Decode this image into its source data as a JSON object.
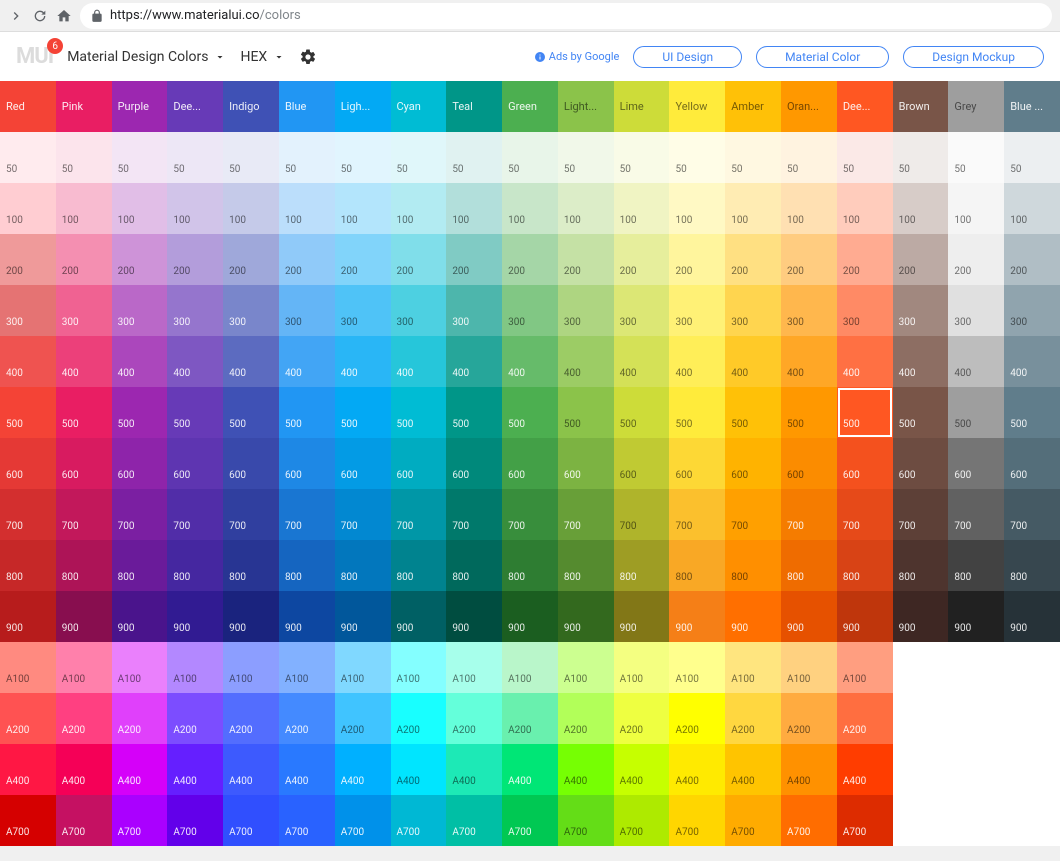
{
  "browser": {
    "url_protocol": "https://",
    "url_domain": "www.materialui.co",
    "url_path": "/colors"
  },
  "header": {
    "logo": "MUI",
    "badge": "6",
    "title": "Material Design Colors",
    "format": "HEX",
    "ads": "Ads by Google",
    "links": [
      "UI Design",
      "Material Color",
      "Design Mockup"
    ]
  },
  "colors": [
    {
      "name": "Red",
      "short": "Red",
      "shades": {
        "500": "#F44336",
        "50": "#FFEBEE",
        "100": "#FFCDD2",
        "200": "#EF9A9A",
        "300": "#E57373",
        "400": "#EF5350",
        "600": "#E53935",
        "700": "#D32F2F",
        "800": "#C62828",
        "900": "#B71C1C",
        "A100": "#FF8A80",
        "A200": "#FF5252",
        "A400": "#FF1744",
        "A700": "#D50000"
      }
    },
    {
      "name": "Pink",
      "short": "Pink",
      "shades": {
        "500": "#E91E63",
        "50": "#FCE4EC",
        "100": "#F8BBD0",
        "200": "#F48FB1",
        "300": "#F06292",
        "400": "#EC407A",
        "600": "#D81B60",
        "700": "#C2185B",
        "800": "#AD1457",
        "900": "#880E4F",
        "A100": "#FF80AB",
        "A200": "#FF4081",
        "A400": "#F50057",
        "A700": "#C51162"
      }
    },
    {
      "name": "Purple",
      "short": "Purple",
      "shades": {
        "500": "#9C27B0",
        "50": "#F3E5F5",
        "100": "#E1BEE7",
        "200": "#CE93D8",
        "300": "#BA68C8",
        "400": "#AB47BC",
        "600": "#8E24AA",
        "700": "#7B1FA2",
        "800": "#6A1B9A",
        "900": "#4A148C",
        "A100": "#EA80FC",
        "A200": "#E040FB",
        "A400": "#D500F9",
        "A700": "#AA00FF"
      }
    },
    {
      "name": "Deep Purple",
      "short": "Dee...",
      "shades": {
        "500": "#673AB7",
        "50": "#EDE7F6",
        "100": "#D1C4E9",
        "200": "#B39DDB",
        "300": "#9575CD",
        "400": "#7E57C2",
        "600": "#5E35B1",
        "700": "#512DA8",
        "800": "#4527A0",
        "900": "#311B92",
        "A100": "#B388FF",
        "A200": "#7C4DFF",
        "A400": "#651FFF",
        "A700": "#6200EA"
      }
    },
    {
      "name": "Indigo",
      "short": "Indigo",
      "shades": {
        "500": "#3F51B5",
        "50": "#E8EAF6",
        "100": "#C5CAE9",
        "200": "#9FA8DA",
        "300": "#7986CB",
        "400": "#5C6BC0",
        "600": "#3949AB",
        "700": "#303F9F",
        "800": "#283593",
        "900": "#1A237E",
        "A100": "#8C9EFF",
        "A200": "#536DFE",
        "A400": "#3D5AFE",
        "A700": "#304FFE"
      }
    },
    {
      "name": "Blue",
      "short": "Blue",
      "shades": {
        "500": "#2196F3",
        "50": "#E3F2FD",
        "100": "#BBDEFB",
        "200": "#90CAF9",
        "300": "#64B5F6",
        "400": "#42A5F5",
        "600": "#1E88E5",
        "700": "#1976D2",
        "800": "#1565C0",
        "900": "#0D47A1",
        "A100": "#82B1FF",
        "A200": "#448AFF",
        "A400": "#2979FF",
        "A700": "#2962FF"
      }
    },
    {
      "name": "Light Blue",
      "short": "Ligh...",
      "shades": {
        "500": "#03A9F4",
        "50": "#E1F5FE",
        "100": "#B3E5FC",
        "200": "#81D4FA",
        "300": "#4FC3F7",
        "400": "#29B6F6",
        "600": "#039BE5",
        "700": "#0288D1",
        "800": "#0277BD",
        "900": "#01579B",
        "A100": "#80D8FF",
        "A200": "#40C4FF",
        "A400": "#00B0FF",
        "A700": "#0091EA"
      }
    },
    {
      "name": "Cyan",
      "short": "Cyan",
      "shades": {
        "500": "#00BCD4",
        "50": "#E0F7FA",
        "100": "#B2EBF2",
        "200": "#80DEEA",
        "300": "#4DD0E1",
        "400": "#26C6DA",
        "600": "#00ACC1",
        "700": "#0097A7",
        "800": "#00838F",
        "900": "#006064",
        "A100": "#84FFFF",
        "A200": "#18FFFF",
        "A400": "#00E5FF",
        "A700": "#00B8D4"
      }
    },
    {
      "name": "Teal",
      "short": "Teal",
      "shades": {
        "500": "#009688",
        "50": "#E0F2F1",
        "100": "#B2DFDB",
        "200": "#80CBC4",
        "300": "#4DB6AC",
        "400": "#26A69A",
        "600": "#00897B",
        "700": "#00796B",
        "800": "#00695C",
        "900": "#004D40",
        "A100": "#A7FFEB",
        "A200": "#64FFDA",
        "A400": "#1DE9B6",
        "A700": "#00BFA5"
      }
    },
    {
      "name": "Green",
      "short": "Green",
      "shades": {
        "500": "#4CAF50",
        "50": "#E8F5E9",
        "100": "#C8E6C9",
        "200": "#A5D6A7",
        "300": "#81C784",
        "400": "#66BB6A",
        "600": "#43A047",
        "700": "#388E3C",
        "800": "#2E7D32",
        "900": "#1B5E20",
        "A100": "#B9F6CA",
        "A200": "#69F0AE",
        "A400": "#00E676",
        "A700": "#00C853"
      }
    },
    {
      "name": "Light Green",
      "short": "Light...",
      "shades": {
        "500": "#8BC34A",
        "50": "#F1F8E9",
        "100": "#DCEDC8",
        "200": "#C5E1A5",
        "300": "#AED581",
        "400": "#9CCC65",
        "600": "#7CB342",
        "700": "#689F38",
        "800": "#558B2F",
        "900": "#33691E",
        "A100": "#CCFF90",
        "A200": "#B2FF59",
        "A400": "#76FF03",
        "A700": "#64DD17"
      }
    },
    {
      "name": "Lime",
      "short": "Lime",
      "shades": {
        "500": "#CDDC39",
        "50": "#F9FBE7",
        "100": "#F0F4C3",
        "200": "#E6EE9C",
        "300": "#DCE775",
        "400": "#D4E157",
        "600": "#C0CA33",
        "700": "#AFB42B",
        "800": "#9E9D24",
        "900": "#827717",
        "A100": "#F4FF81",
        "A200": "#EEFF41",
        "A400": "#C6FF00",
        "A700": "#AEEA00"
      }
    },
    {
      "name": "Yellow",
      "short": "Yellow",
      "shades": {
        "500": "#FFEB3B",
        "50": "#FFFDE7",
        "100": "#FFF9C4",
        "200": "#FFF59D",
        "300": "#FFF176",
        "400": "#FFEE58",
        "600": "#FDD835",
        "700": "#FBC02D",
        "800": "#F9A825",
        "900": "#F57F17",
        "A100": "#FFFF8D",
        "A200": "#FFFF00",
        "A400": "#FFEA00",
        "A700": "#FFD600"
      }
    },
    {
      "name": "Amber",
      "short": "Amber",
      "shades": {
        "500": "#FFC107",
        "50": "#FFF8E1",
        "100": "#FFECB3",
        "200": "#FFE082",
        "300": "#FFD54F",
        "400": "#FFCA28",
        "600": "#FFB300",
        "700": "#FFA000",
        "800": "#FF8F00",
        "900": "#FF6F00",
        "A100": "#FFE57F",
        "A200": "#FFD740",
        "A400": "#FFC400",
        "A700": "#FFAB00"
      }
    },
    {
      "name": "Orange",
      "short": "Oran...",
      "shades": {
        "500": "#FF9800",
        "50": "#FFF3E0",
        "100": "#FFE0B2",
        "200": "#FFCC80",
        "300": "#FFB74D",
        "400": "#FFA726",
        "600": "#FB8C00",
        "700": "#F57C00",
        "800": "#EF6C00",
        "900": "#E65100",
        "A100": "#FFD180",
        "A200": "#FFAB40",
        "A400": "#FF9100",
        "A700": "#FF6D00"
      }
    },
    {
      "name": "Deep Orange",
      "short": "Dee...",
      "shades": {
        "500": "#FF5722",
        "50": "#FBE9E7",
        "100": "#FFCCBC",
        "200": "#FFAB91",
        "300": "#FF8A65",
        "400": "#FF7043",
        "600": "#F4511E",
        "700": "#E64A19",
        "800": "#D84315",
        "900": "#BF360C",
        "A100": "#FF9E80",
        "A200": "#FF6E40",
        "A400": "#FF3D00",
        "A700": "#DD2C00"
      }
    },
    {
      "name": "Brown",
      "short": "Brown",
      "shades": {
        "500": "#795548",
        "50": "#EFEBE9",
        "100": "#D7CCC8",
        "200": "#BCAAA4",
        "300": "#A1887F",
        "400": "#8D6E63",
        "600": "#6D4C41",
        "700": "#5D4037",
        "800": "#4E342E",
        "900": "#3E2723"
      }
    },
    {
      "name": "Grey",
      "short": "Grey",
      "shades": {
        "500": "#9E9E9E",
        "50": "#FAFAFA",
        "100": "#F5F5F5",
        "200": "#EEEEEE",
        "300": "#E0E0E0",
        "400": "#BDBDBD",
        "600": "#757575",
        "700": "#616161",
        "800": "#424242",
        "900": "#212121"
      }
    },
    {
      "name": "Blue Grey",
      "short": "Blue ...",
      "shades": {
        "500": "#607D8B",
        "50": "#ECEFF1",
        "100": "#CFD8DC",
        "200": "#B0BEC5",
        "300": "#90A4AE",
        "400": "#78909C",
        "600": "#546E7A",
        "700": "#455A64",
        "800": "#37474F",
        "900": "#263238"
      }
    }
  ],
  "rows": [
    "50",
    "100",
    "200",
    "300",
    "400",
    "500",
    "600",
    "700",
    "800",
    "900",
    "A100",
    "A200",
    "A400",
    "A700"
  ],
  "selected": {
    "color": 15,
    "shade": "500"
  }
}
